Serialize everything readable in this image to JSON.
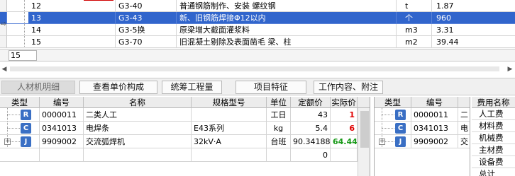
{
  "top_grid": {
    "rows": [
      {
        "no": "12",
        "code": "G3-40",
        "name": "普通钢筋制作、安装 螺纹钢",
        "unit": "t",
        "qty": "1.87",
        "selected": false
      },
      {
        "no": "13",
        "code": "G3-43",
        "name": "新、旧钢筋焊接Φ12以内",
        "unit": "个",
        "qty": "960",
        "selected": true
      },
      {
        "no": "14",
        "code": "G3-5换",
        "name": "原梁增大截面灌浆料",
        "unit": "m3",
        "qty": "3.31",
        "selected": false
      },
      {
        "no": "15",
        "code": "G3-70",
        "name": "旧混凝土剔除及表面凿毛 梁、柱",
        "unit": "m2",
        "qty": "39.44",
        "selected": false
      }
    ],
    "editor_value": "15",
    "row_pointer": "⇨"
  },
  "tabs": [
    {
      "label": "人材机明细",
      "active": true
    },
    {
      "label": "查看单价构成",
      "active": false
    },
    {
      "label": "统筹工程量",
      "active": false
    },
    {
      "label": "项目特征",
      "active": false
    },
    {
      "label": "工作内容、附注",
      "active": false
    }
  ],
  "resource_grid": {
    "headers": [
      "类型",
      "编号",
      "名称",
      "规格型号",
      "单位",
      "定额价",
      "实际价"
    ],
    "rows": [
      {
        "type": "R",
        "code": "0000011",
        "name": "二类人工",
        "spec": "",
        "unit": "工日",
        "price": "43",
        "actual": "1",
        "actual_color": "#e00000",
        "expandable": false
      },
      {
        "type": "C",
        "code": "0341013",
        "name": "电焊条",
        "spec": "E43系列",
        "unit": "kg",
        "price": "5.4",
        "actual": "6",
        "actual_color": "#e00000",
        "expandable": false
      },
      {
        "type": "J",
        "code": "9909002",
        "name": "交流弧焊机",
        "spec": "32kV·A",
        "unit": "台班",
        "price": "90.34188",
        "actual": "64.44",
        "actual_color": "#1a9a1a",
        "expandable": true
      },
      {
        "type": "",
        "code": "",
        "name": "",
        "spec": "",
        "unit": "",
        "price": "0",
        "actual": "",
        "actual_color": "#000000",
        "expandable": false
      }
    ]
  },
  "summary_grid": {
    "headers": [
      "类型",
      "编号",
      ""
    ],
    "rows": [
      {
        "type": "R",
        "code": "0000011",
        "extra": "二",
        "expandable": false
      },
      {
        "type": "C",
        "code": "0341013",
        "extra": "电",
        "expandable": false
      },
      {
        "type": "J",
        "code": "9909002",
        "extra": "交",
        "expandable": true
      }
    ]
  },
  "fee_panel": {
    "header": "费用名称",
    "items": [
      "人工费",
      "材料费",
      "机械费",
      "主材费",
      "设备费",
      "总计"
    ]
  }
}
